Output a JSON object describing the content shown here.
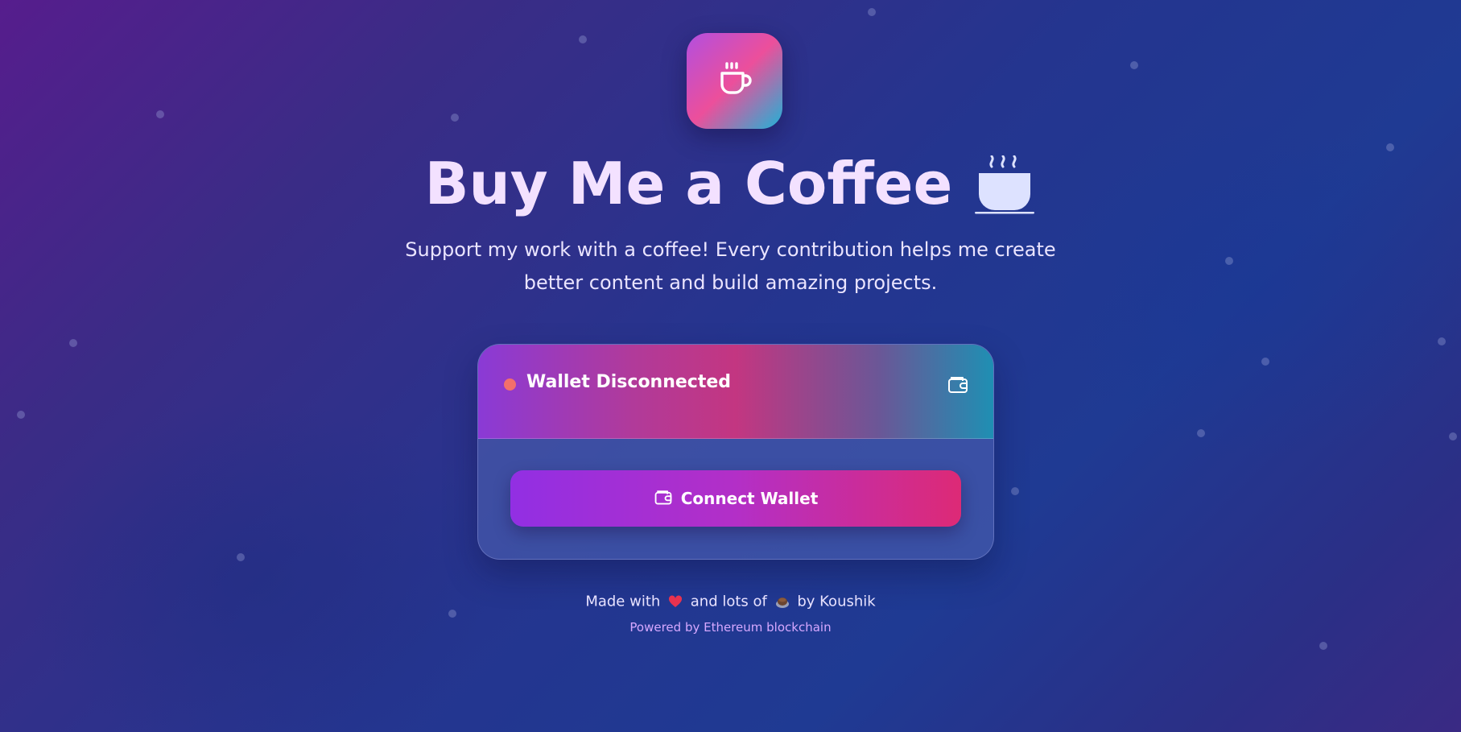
{
  "header": {
    "logo_icon": "coffee-cup-icon",
    "title": "Buy Me a Coffee",
    "title_icon": "hot-beverage-icon",
    "subtitle": "Support my work with a coffee! Every contribution helps me create better content and build amazing projects."
  },
  "wallet_card": {
    "status_label": "Wallet Disconnected",
    "status_color": "#f36f6b",
    "header_icon": "wallet-icon",
    "connect_button_label": "Connect Wallet",
    "connect_button_icon": "wallet-icon"
  },
  "footer": {
    "made_with_prefix": "Made with",
    "heart_icon": "red-heart-icon",
    "and_lots_of": "and lots of",
    "coffee_icon": "coffee-emoji-icon",
    "by_author": "by Koushik",
    "powered_by": "Powered by Ethereum blockchain"
  },
  "colors": {
    "accent_purple": "#922fe3",
    "accent_pink": "#dd2a76",
    "title_text": "#f3e1ff",
    "powered_text": "#d6a8ff"
  }
}
